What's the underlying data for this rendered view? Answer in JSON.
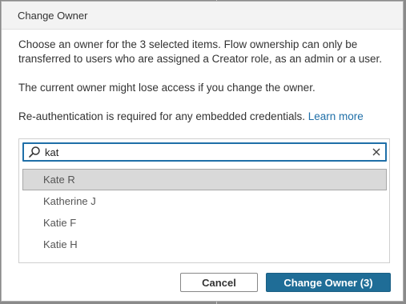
{
  "dialog": {
    "title": "Change Owner",
    "paragraph_1": "Choose an owner for the 3 selected items. Flow ownership can only be transferred to users who are assigned a Creator role, as an admin or a user.",
    "paragraph_2": "The current owner might lose access if you change the owner.",
    "paragraph_3_text": "Re-authentication is required for any embedded credentials.",
    "paragraph_3_link": "Learn more"
  },
  "search": {
    "value": "kat",
    "icon": "search-icon",
    "clear_icon": "close-icon"
  },
  "results": [
    {
      "name": "Kate R",
      "selected": true
    },
    {
      "name": "Katherine J",
      "selected": false
    },
    {
      "name": "Katie F",
      "selected": false
    },
    {
      "name": "Katie H",
      "selected": false
    }
  ],
  "buttons": {
    "cancel": "Cancel",
    "confirm": "Change Owner (3)"
  },
  "colors": {
    "accent": "#1f6fa8",
    "primary_button": "#1f6d97",
    "selected_row": "#d9d9d9"
  }
}
